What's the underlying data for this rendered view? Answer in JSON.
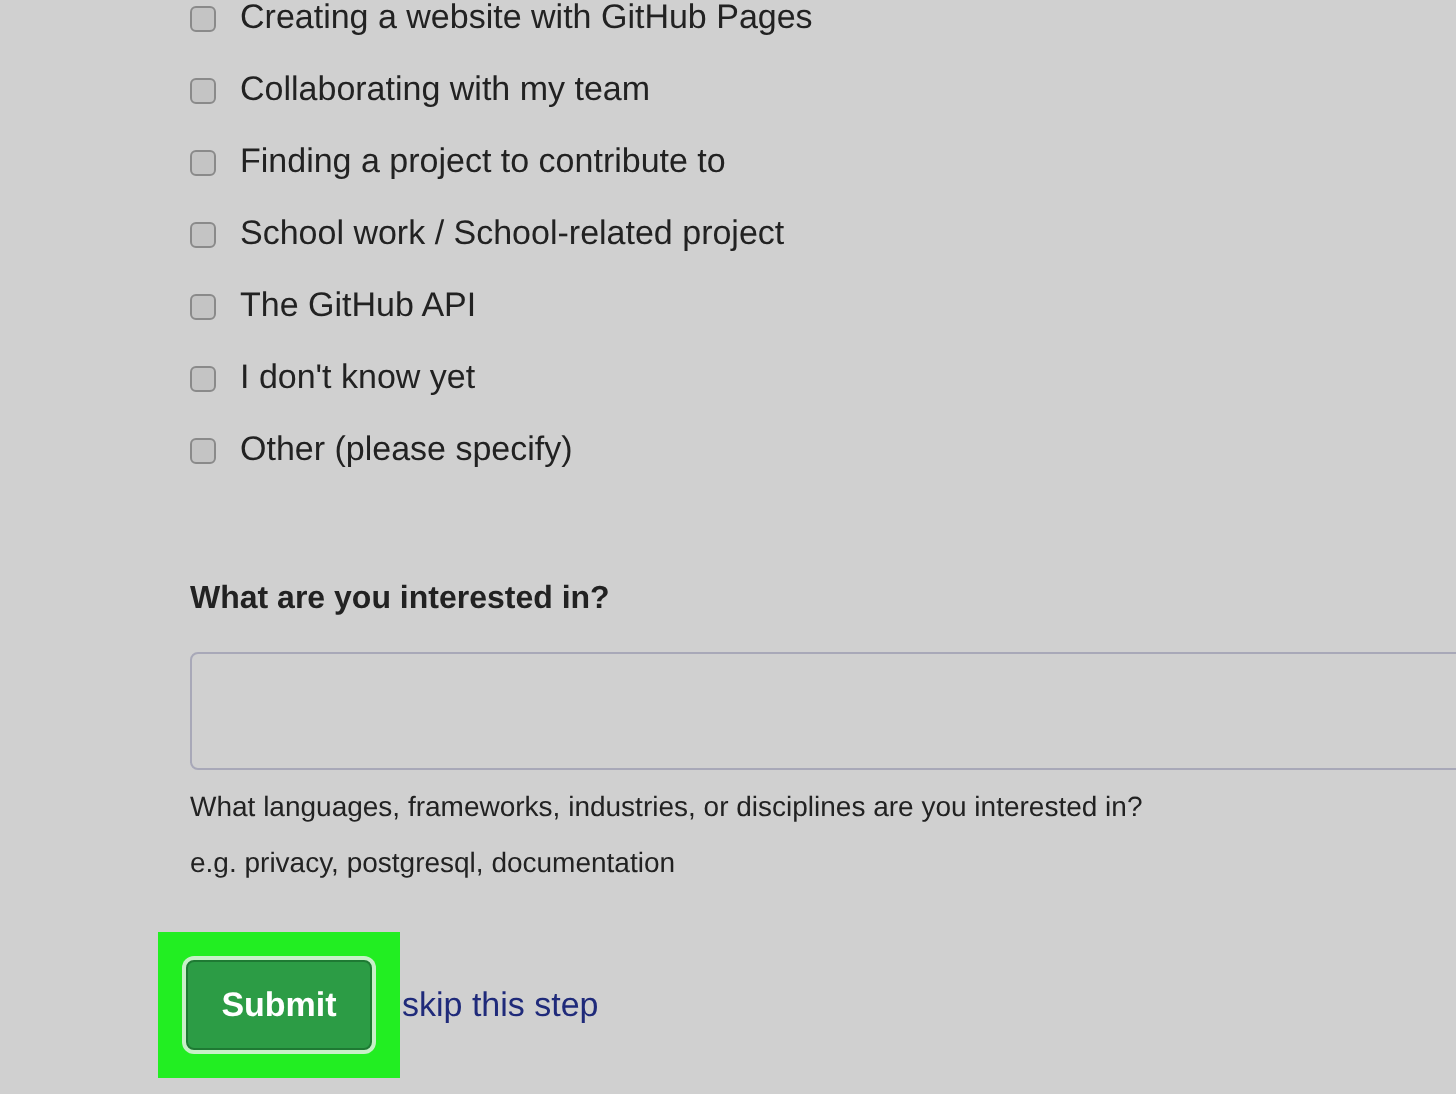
{
  "options": [
    {
      "label": "Creating a website with GitHub Pages",
      "checked": false
    },
    {
      "label": "Collaborating with my team",
      "checked": false
    },
    {
      "label": "Finding a project to contribute to",
      "checked": false
    },
    {
      "label": "School work / School-related project",
      "checked": false
    },
    {
      "label": "The GitHub API",
      "checked": false
    },
    {
      "label": "I don't know yet",
      "checked": false
    },
    {
      "label": "Other (please specify)",
      "checked": false
    }
  ],
  "interest": {
    "label": "What are you interested in?",
    "hint": "What languages, frameworks, industries, or disciplines are you interested in?",
    "example": "e.g. privacy, postgresql, documentation"
  },
  "submit": {
    "label": "Submit",
    "highlighted": true
  },
  "skip_link": "skip this step"
}
